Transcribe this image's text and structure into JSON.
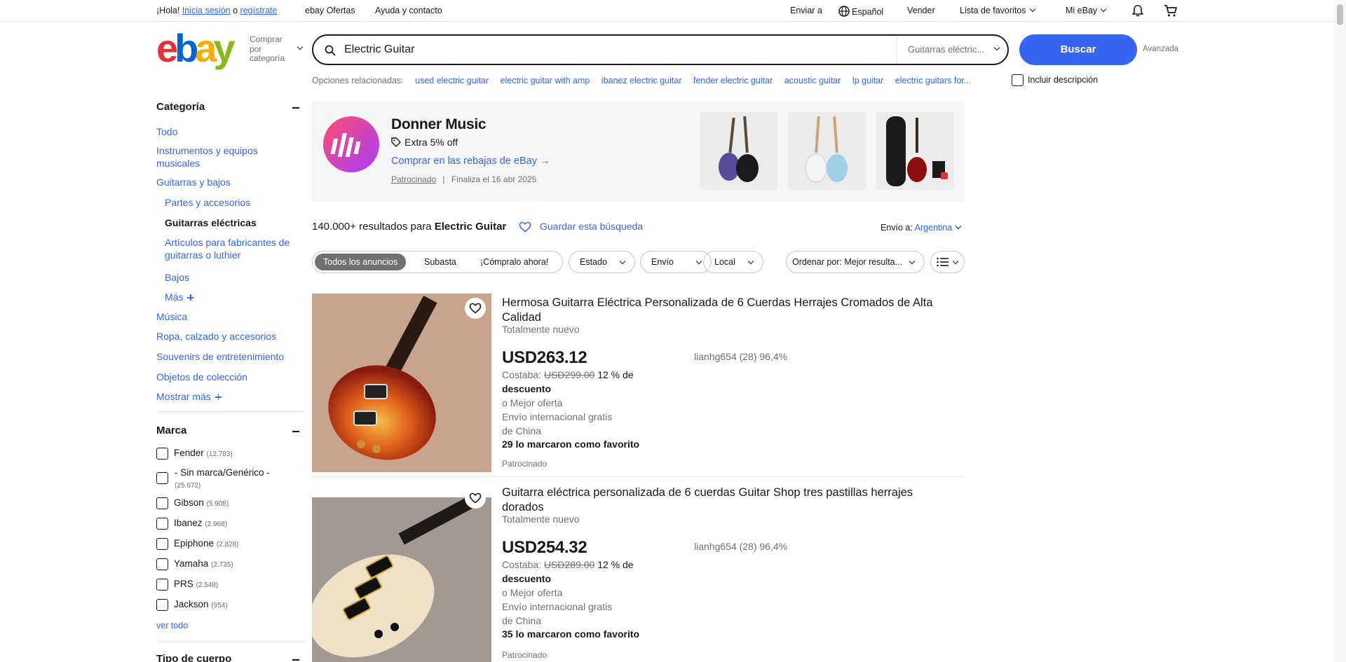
{
  "topbar": {
    "greeting": "¡Hola!",
    "signin": "Inicia sesión",
    "or": "o",
    "register": "regístrate",
    "deals": "ebay Ofertas",
    "help": "Ayuda y contacto",
    "ship_to": "Enviar a",
    "language": "Español",
    "sell": "Vender",
    "watchlist": "Lista de favoritos",
    "my_ebay": "Mi eBay"
  },
  "header": {
    "logo_letters": [
      "e",
      "b",
      "a",
      "y"
    ],
    "shop_by_category": "Comprar por categoría",
    "search_value": "Electric Guitar",
    "category_select": "Guitarras eléctric...",
    "search_button": "Buscar",
    "advanced": "Avanzada"
  },
  "related": {
    "label": "Opciones relacionadas:",
    "links": [
      "used electric guitar",
      "electric guitar with amp",
      "ibanez electric guitar",
      "fender electric guitar",
      "acoustic guitar",
      "lp guitar",
      "electric guitars for..."
    ],
    "include_description": "Incluir descripción"
  },
  "sidebar": {
    "category_heading": "Categoría",
    "categories": [
      "Todo",
      "Instrumentos y equipos musicales",
      "Guitarras y bajos",
      "Partes y accesorios",
      "Guitarras eléctricas",
      "Artículos para fabricantes de guitarras o luthier",
      "Bajos",
      "Más",
      "Música",
      "Ropa, calzado y accesorios",
      "Souvenirs de entretenimiento",
      "Objetos de colección",
      "Mostrar más"
    ],
    "brand_heading": "Marca",
    "brands": [
      {
        "name": "Fender",
        "count": "(12.783)"
      },
      {
        "name": "- Sin marca/Genérico -",
        "count": "(25.672)"
      },
      {
        "name": "Gibson",
        "count": "(5.908)"
      },
      {
        "name": "Ibanez",
        "count": "(2.968)"
      },
      {
        "name": "Epiphone",
        "count": "(2.828)"
      },
      {
        "name": "Yamaha",
        "count": "(2.735)"
      },
      {
        "name": "PRS",
        "count": "(2.548)"
      },
      {
        "name": "Jackson",
        "count": "(954)"
      }
    ],
    "see_all": "ver todo",
    "body_type_heading": "Tipo de cuerpo"
  },
  "banner": {
    "title": "Donner Music",
    "offer": "Extra 5% off",
    "cta": "Comprar en las rebajas de eBay",
    "sponsored": "Patrocinado",
    "separator": "|",
    "ends": "Finaliza el 16 abr 2025"
  },
  "results": {
    "count": "140.000+",
    "count_suffix": "resultados para",
    "query": "Electric Guitar",
    "save_search": "Guardar esta búsqueda",
    "ship_to_label": "Envío a:",
    "ship_to_country": "Argentina"
  },
  "filters": {
    "segments": [
      "Todos los anuncios",
      "Subasta",
      "¡Cómpralo ahora!"
    ],
    "pills": [
      "Estado",
      "Envío",
      "Local"
    ],
    "sort": "Ordenar por: Mejor resulta..."
  },
  "listings": [
    {
      "title": "Hermosa Guitarra Eléctrica Personalizada de 6 Cuerdas Herrajes Cromados de Alta Calidad",
      "condition": "Totalmente nuevo",
      "price": "USD263.12",
      "was_label": "Costaba:",
      "was_price": "USD299.00",
      "discount_a": "12 % de",
      "discount_b": "descuento",
      "best_offer": "o Mejor oferta",
      "shipping": "Envío internacional gratis",
      "origin": "de China",
      "watchers": "29 lo marcaron como favorito",
      "sponsored": "Patrocinado",
      "seller": "lianhg654 (28) 96,4%"
    },
    {
      "title": "Guitarra eléctrica personalizada de 6 cuerdas Guitar Shop tres pastillas herrajes dorados",
      "condition": "Totalmente nuevo",
      "price": "USD254.32",
      "was_label": "Costaba:",
      "was_price": "USD289.00",
      "discount_a": "12 % de",
      "discount_b": "descuento",
      "best_offer": "o Mejor oferta",
      "shipping": "Envío internacional gratis",
      "origin": "de China",
      "watchers": "35 lo marcaron como favorito",
      "sponsored": "Patrocinado",
      "seller": "lianhg654 (28) 96,4%"
    }
  ],
  "colors": {
    "accent": "#3665f3",
    "logo_e": "#e53238",
    "logo_b": "#0064d2",
    "logo_a": "#f5af02",
    "logo_y": "#86b817"
  },
  "icons": [
    "search-icon",
    "globe-icon",
    "bell-icon",
    "cart-icon",
    "heart-icon",
    "tag-icon",
    "list-view-icon",
    "chevron-down-icon"
  ]
}
